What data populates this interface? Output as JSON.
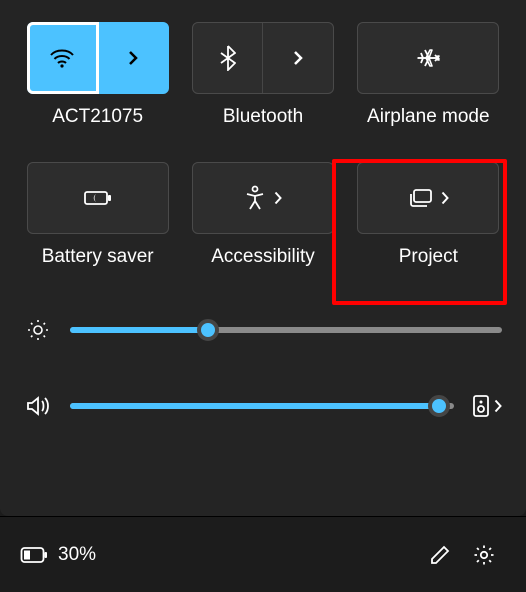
{
  "tiles": {
    "wifi": {
      "label": "ACT21075",
      "active": true
    },
    "bluetooth": {
      "label": "Bluetooth"
    },
    "airplane": {
      "label": "Airplane mode"
    },
    "battery": {
      "label": "Battery saver"
    },
    "accessibility": {
      "label": "Accessibility"
    },
    "project": {
      "label": "Project"
    }
  },
  "sliders": {
    "brightness": {
      "percent": 32
    },
    "volume": {
      "percent": 96
    }
  },
  "status": {
    "battery_text": "30%"
  },
  "colors": {
    "accent": "#4cc2ff",
    "highlight": "#ff0000"
  }
}
